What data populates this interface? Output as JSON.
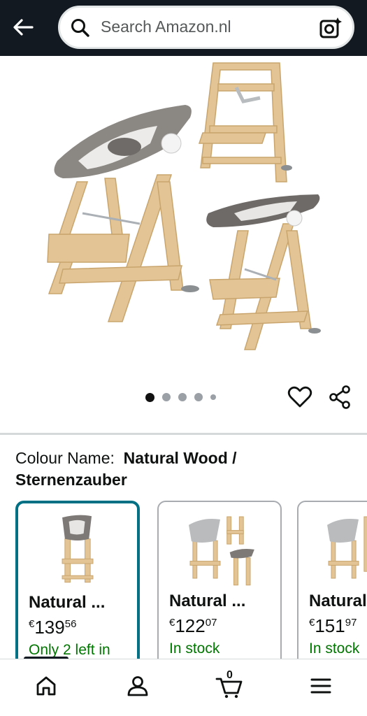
{
  "header": {
    "search_placeholder": "Search Amazon.nl"
  },
  "gallery": {
    "image_count": 5,
    "active_index": 0
  },
  "product": {
    "colour_label": "Colour Name:",
    "colour_value": "Natural Wood / Sternenzauber"
  },
  "variants": [
    {
      "name": "Natural ...",
      "currency": "€",
      "price_whole": "139",
      "price_fraction": "56",
      "stock": "Only 2 left in",
      "selected": true
    },
    {
      "name": "Natural ...",
      "currency": "€",
      "price_whole": "122",
      "price_fraction": "07",
      "stock": "In stock",
      "selected": false
    },
    {
      "name": "Natural ...",
      "currency": "€",
      "price_whole": "151",
      "price_fraction": "97",
      "stock": "In stock",
      "selected": false
    }
  ],
  "nav": {
    "cart_count": "0",
    "active": "home"
  },
  "colors": {
    "header_bg": "#131921",
    "selected_border": "#007185",
    "stock_green": "#007600"
  }
}
